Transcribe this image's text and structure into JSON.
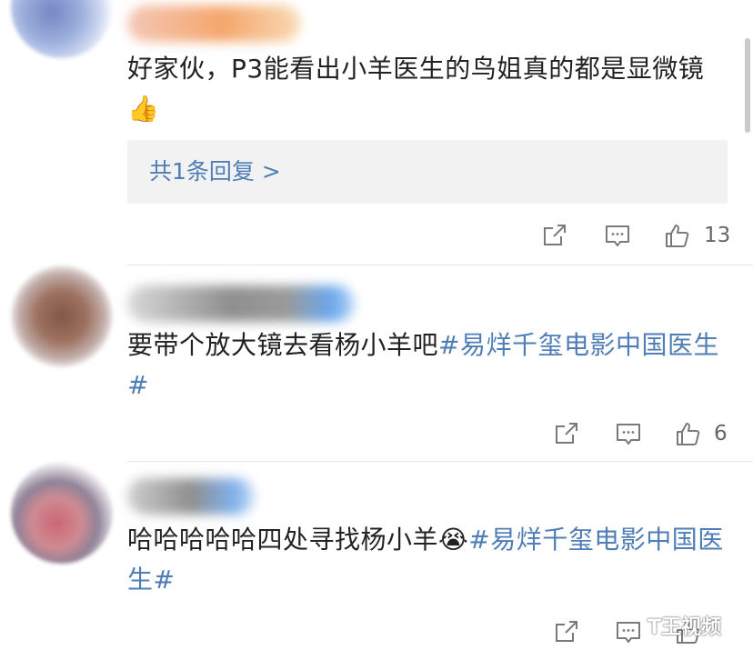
{
  "comments": [
    {
      "text": "好家伙，P3能看出小羊医生的鸟姐真的都是显微镜",
      "emoji": "👍",
      "topic": "",
      "replies_label": "共1条回复 >",
      "likes": "13"
    },
    {
      "text": "要带个放大镜去看杨小羊吧",
      "emoji": "",
      "topic": "#易烊千玺电影中国医生#",
      "likes": "6"
    },
    {
      "text": "哈哈哈哈哈四处寻找杨小羊",
      "emoji": "😭",
      "topic": "#易烊千玺电影中国医生#",
      "likes": ""
    }
  ],
  "icons": {
    "share": "share-icon",
    "comment": "comment-icon",
    "like": "thumbs-up-icon"
  },
  "colors": {
    "topic": "#4f7db6",
    "reply_bg": "#f2f2f2",
    "icon": "#7a7a7a"
  },
  "watermark": "T王视频"
}
